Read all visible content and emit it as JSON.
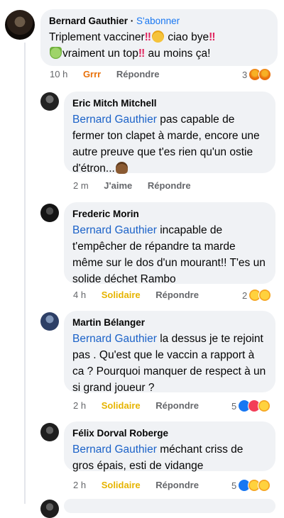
{
  "comments": [
    {
      "author": "Bernard Gauthier",
      "follow": "S'abonner",
      "text_1": "Triplement vacciner",
      "text_2": "ciao bye",
      "text_3": "vraiment un top",
      "text_4": "au moins ça!",
      "time": "10 h",
      "reaction_label": "Grrr",
      "reply": "Répondre",
      "reaction_count": "3"
    },
    {
      "author": "Eric Mitch Mitchell",
      "mention": "Bernard Gauthier",
      "text": " pas capable de fermer ton clapet à marde, encore une autre preuve que t'es rien qu'un ostie d'étron...",
      "time": "2 m",
      "reaction_label": "J'aime",
      "reply": "Répondre"
    },
    {
      "author": "Frederic Morin",
      "mention": "Bernard Gauthier",
      "text": " incapable de t'empêcher de répandre ta marde même sur le dos d'un mourant!! T'es un solide déchet Rambo",
      "time": "4 h",
      "reaction_label": "Solidaire",
      "reply": "Répondre",
      "reaction_count": "2"
    },
    {
      "author": "Martin Bélanger",
      "mention": "Bernard Gauthier",
      "text": "  la dessus je te rejoint pas . Qu'est que le vaccin a rapport à ca ?  Pourquoi manquer de respect à un si grand joueur ?",
      "time": "2 h",
      "reaction_label": "Solidaire",
      "reply": "Répondre",
      "reaction_count": "5"
    },
    {
      "author": "Félix Dorval Roberge",
      "mention": "Bernard Gauthier",
      "text": " méchant criss de gros épais, esti de vidange",
      "time": "2 h",
      "reaction_label": "Solidaire",
      "reply": "Répondre",
      "reaction_count": "5"
    }
  ],
  "icons": {
    "bang": "‼",
    "sad": "sad-face-emoji",
    "sick": "nauseated-face-emoji",
    "poop": "pile-of-poo-emoji"
  },
  "colors": {
    "link": "#1877f2",
    "grrr": "#e8720c",
    "solidaire": "#e6b400",
    "bubble": "#f0f2f5"
  }
}
